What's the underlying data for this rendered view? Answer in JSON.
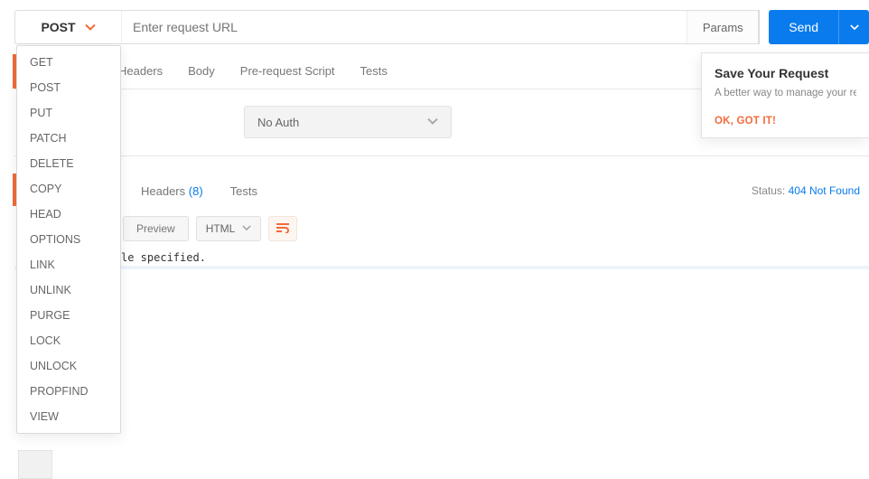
{
  "request": {
    "method": "POST",
    "url_placeholder": "Enter request URL",
    "params_label": "Params",
    "send_label": "Send"
  },
  "method_options": [
    "GET",
    "POST",
    "PUT",
    "PATCH",
    "DELETE",
    "COPY",
    "HEAD",
    "OPTIONS",
    "LINK",
    "UNLINK",
    "PURGE",
    "LOCK",
    "UNLOCK",
    "PROPFIND",
    "VIEW"
  ],
  "req_tabs": {
    "headers": "Headers",
    "body": "Body",
    "prerequest": "Pre-request Script",
    "tests": "Tests"
  },
  "auth": {
    "selected": "No Auth"
  },
  "res_tabs": {
    "headers": "Headers",
    "headers_count": "(8)",
    "tests": "Tests"
  },
  "status": {
    "label": "Status:",
    "value": "404 Not Found"
  },
  "res_toolbar": {
    "preview": "Preview",
    "format": "HTML"
  },
  "response_body": {
    "line1": "le specified.",
    "line2": " "
  },
  "save_popover": {
    "title": "Save Your Request",
    "body": "A better way to manage your re\nsave it to your Collections for la",
    "ok": "OK, GOT IT!"
  }
}
